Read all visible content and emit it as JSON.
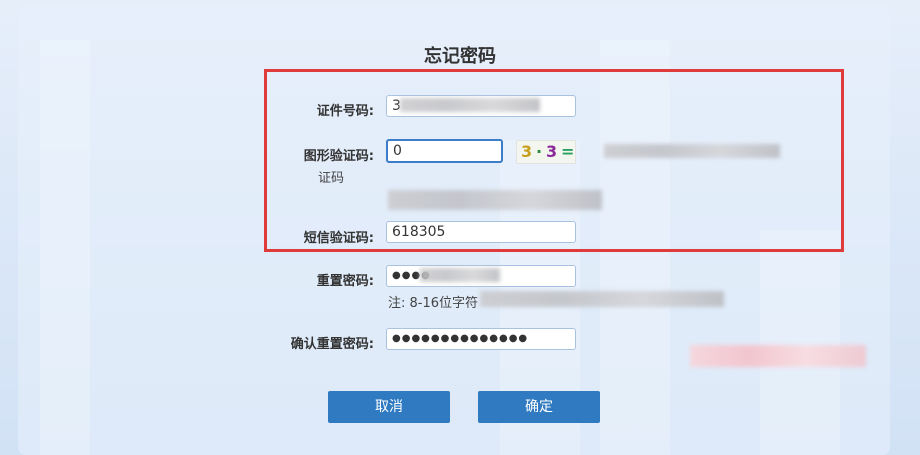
{
  "page": {
    "title": "忘记密码"
  },
  "form": {
    "id_number": {
      "label": "证件号码:",
      "value": "3"
    },
    "captcha": {
      "label": "图形验证码:",
      "value": "0",
      "sublabel": "证码",
      "image_text": [
        "3",
        "·",
        "3",
        "="
      ]
    },
    "sms": {
      "label": "短信验证码:",
      "value": "618305"
    },
    "reset_password": {
      "label": "重置密码:",
      "value": "●●●●",
      "hint": "注: 8-16位字符"
    },
    "confirm_password": {
      "label": "确认重置密码:",
      "value": "●●●●●●●●●●●●●●"
    }
  },
  "buttons": {
    "cancel": "取消",
    "confirm": "确定"
  },
  "colors": {
    "primary": "#2f7ac1",
    "highlight_box": "#e03b3b",
    "focus_border": "#3c7cc8"
  }
}
